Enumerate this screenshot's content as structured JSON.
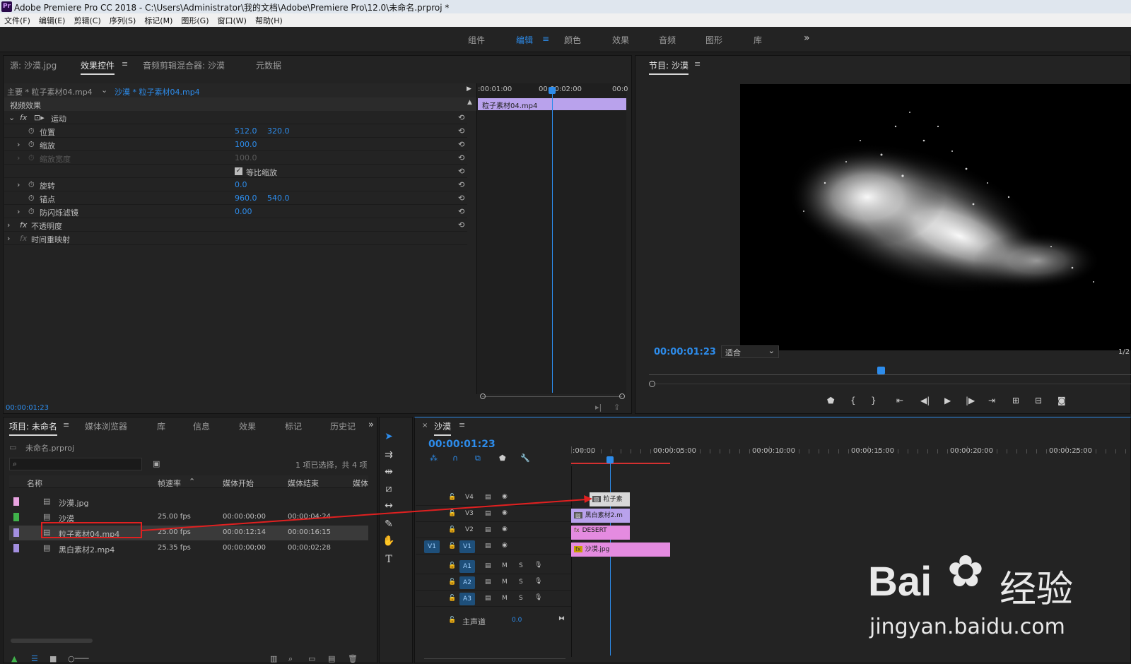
{
  "titlebar": {
    "title": "Adobe Premiere Pro CC 2018 - C:\\Users\\Administrator\\我的文档\\Adobe\\Premiere Pro\\12.0\\未命名.prproj *",
    "logo": "Pr"
  },
  "menu": [
    "文件(F)",
    "编辑(E)",
    "剪辑(C)",
    "序列(S)",
    "标记(M)",
    "图形(G)",
    "窗口(W)",
    "帮助(H)"
  ],
  "workspaces": [
    "组件",
    "编辑",
    "颜色",
    "效果",
    "音频",
    "图形",
    "库"
  ],
  "workspace_more": "»",
  "source_panel": {
    "tabs": [
      "源: 沙漠.jpg",
      "效果控件",
      "音频剪辑混合器: 沙漠",
      "元数据"
    ],
    "master": "主要 * 粒子素材04.mp4",
    "sequence_clip": "沙漠 * 粒子素材04.mp4",
    "section": "视频效果",
    "motion": "运动",
    "props": [
      {
        "name": "位置",
        "v1": "512.0",
        "v2": "320.0"
      },
      {
        "name": "缩放",
        "v1": "100.0",
        "v2": ""
      },
      {
        "name": "缩放宽度",
        "v1": "100.0",
        "v2": ""
      },
      {
        "name": "",
        "v1": "",
        "v2": "等比缩放"
      },
      {
        "name": "旋转",
        "v1": "0.0",
        "v2": ""
      },
      {
        "name": "锚点",
        "v1": "960.0",
        "v2": "540.0"
      },
      {
        "name": "防闪烁滤镜",
        "v1": "0.00",
        "v2": ""
      }
    ],
    "opacity": "不透明度",
    "time_remap": "时间重映射",
    "ruler": [
      ":00:01:00",
      "00:00:02:00",
      "00:0"
    ],
    "mini_clip": "粒子素材04.mp4",
    "timecode": "00:00:01:23"
  },
  "program": {
    "title": "节目: 沙漠",
    "timecode": "00:00:01:23",
    "fit": "适合",
    "ratio": "1/2"
  },
  "project": {
    "tabs": [
      "项目: 未命名",
      "媒体浏览器",
      "库",
      "信息",
      "效果",
      "标记",
      "历史记"
    ],
    "file": "未命名.prproj",
    "selection": "1 项已选择，共 4 项",
    "cols": [
      "名称",
      "帧速率",
      "媒体开始",
      "媒体结束",
      "媒体"
    ],
    "items": [
      {
        "name": "沙漠.jpg",
        "fps": "",
        "start": "",
        "end": "",
        "color": "#e8a3e0",
        "icon": "image-icon"
      },
      {
        "name": "沙漠",
        "fps": "25.00 fps",
        "start": "00:00:00:00",
        "end": "00:00:04:24",
        "color": "#3fb24a",
        "icon": "sequence-icon"
      },
      {
        "name": "粒子素材04.mp4",
        "fps": "25.00 fps",
        "start": "00:00:12:14",
        "end": "00:00:16:15",
        "color": "#a38fe0",
        "icon": "video-icon"
      },
      {
        "name": "黑白素材2.mp4",
        "fps": "25.35 fps",
        "start": "00;00;00;00",
        "end": "00;00;02;28",
        "color": "#a38fe0",
        "icon": "video-icon"
      }
    ]
  },
  "timeline": {
    "title": "沙漠",
    "timecode": "00:00:01:23",
    "ruler": [
      ":00:00",
      "00:00:05:00",
      "00:00:10:00",
      "00:00:15:00",
      "00:00:20:00",
      "00:00:25:00"
    ],
    "video_tracks": [
      "V4",
      "V3",
      "V2",
      "V1"
    ],
    "audio_tracks": [
      "A1",
      "A2",
      "A3"
    ],
    "master": "主声道",
    "master_val": "0.0",
    "clips": [
      {
        "track": "V4",
        "label": "粒子素"
      },
      {
        "track": "V3",
        "label": "黑白素材2.m"
      },
      {
        "track": "V2",
        "label": "DESERT"
      },
      {
        "track": "V1",
        "label": "沙漠.jpg"
      }
    ]
  },
  "watermark": {
    "brand": "Bai",
    "brand2": "经验",
    "url": "jingyan.baidu.com"
  },
  "colors": {
    "accent": "#2d8ceb",
    "clip_purple": "#b9a2ec",
    "clip_pink": "#e48be0",
    "highlight": "#e02020"
  }
}
